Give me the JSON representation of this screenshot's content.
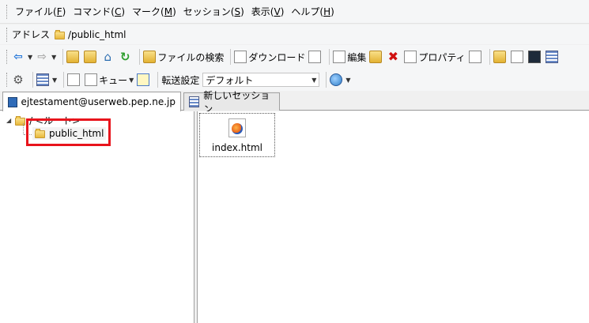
{
  "menu": [
    {
      "label": "ファイル(",
      "key": "F",
      "end": ")"
    },
    {
      "label": "コマンド(",
      "key": "C",
      "end": ")"
    },
    {
      "label": "マーク(",
      "key": "M",
      "end": ")"
    },
    {
      "label": "セッション(",
      "key": "S",
      "end": ")"
    },
    {
      "label": "表示(",
      "key": "V",
      "end": ")"
    },
    {
      "label": "ヘルプ(",
      "key": "H",
      "end": ")"
    }
  ],
  "address": {
    "label": "アドレス",
    "path": "/public_html"
  },
  "toolbar1": {
    "find_files": "ファイルの検索",
    "download": "ダウンロード",
    "edit": "編集",
    "properties": "プロパティ"
  },
  "toolbar2": {
    "queue": "キュー",
    "transfer_settings_label": "転送設定",
    "transfer_settings_value": "デフォルト"
  },
  "tabs": {
    "session": "ejtestament@userweb.pep.ne.jp",
    "new_session": "新しいセッション"
  },
  "tree": {
    "root": "/ <ルート>",
    "child": "public_html"
  },
  "files": [
    {
      "name": "index.html",
      "icon": "firefox-html-icon"
    }
  ],
  "colors": {
    "highlight": "#e8141c",
    "accent": "#1e73d8"
  }
}
